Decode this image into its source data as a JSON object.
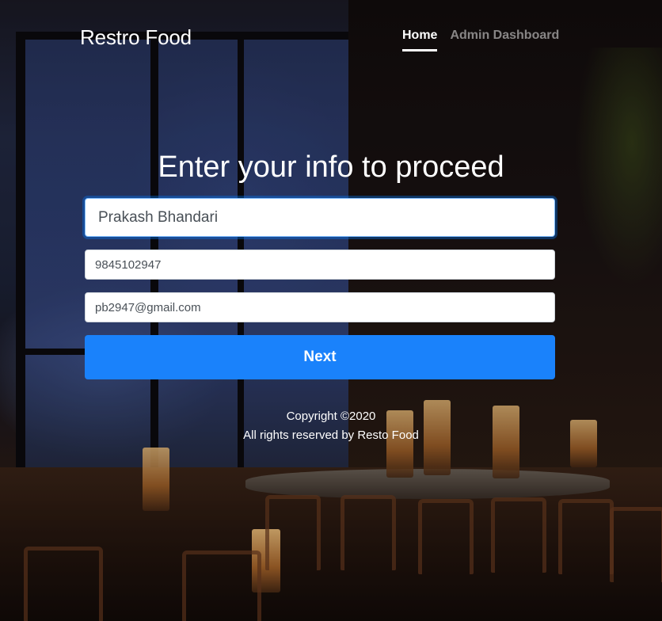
{
  "header": {
    "brand": "Restro Food",
    "nav": [
      {
        "label": "Home",
        "active": true
      },
      {
        "label": "Admin Dashboard",
        "active": false
      }
    ]
  },
  "form": {
    "title": "Enter your info to proceed",
    "name_value": "Prakash Bhandari",
    "phone_value": "9845102947",
    "email_value": "pb2947@gmail.com",
    "next_label": "Next"
  },
  "footer": {
    "line1": "Copyright ©2020",
    "line2": "All rights reserved by Resto Food"
  },
  "colors": {
    "primary_button": "#1a82fb",
    "text_light": "#ffffff",
    "nav_inactive": "rgba(255,255,255,0.5)"
  }
}
